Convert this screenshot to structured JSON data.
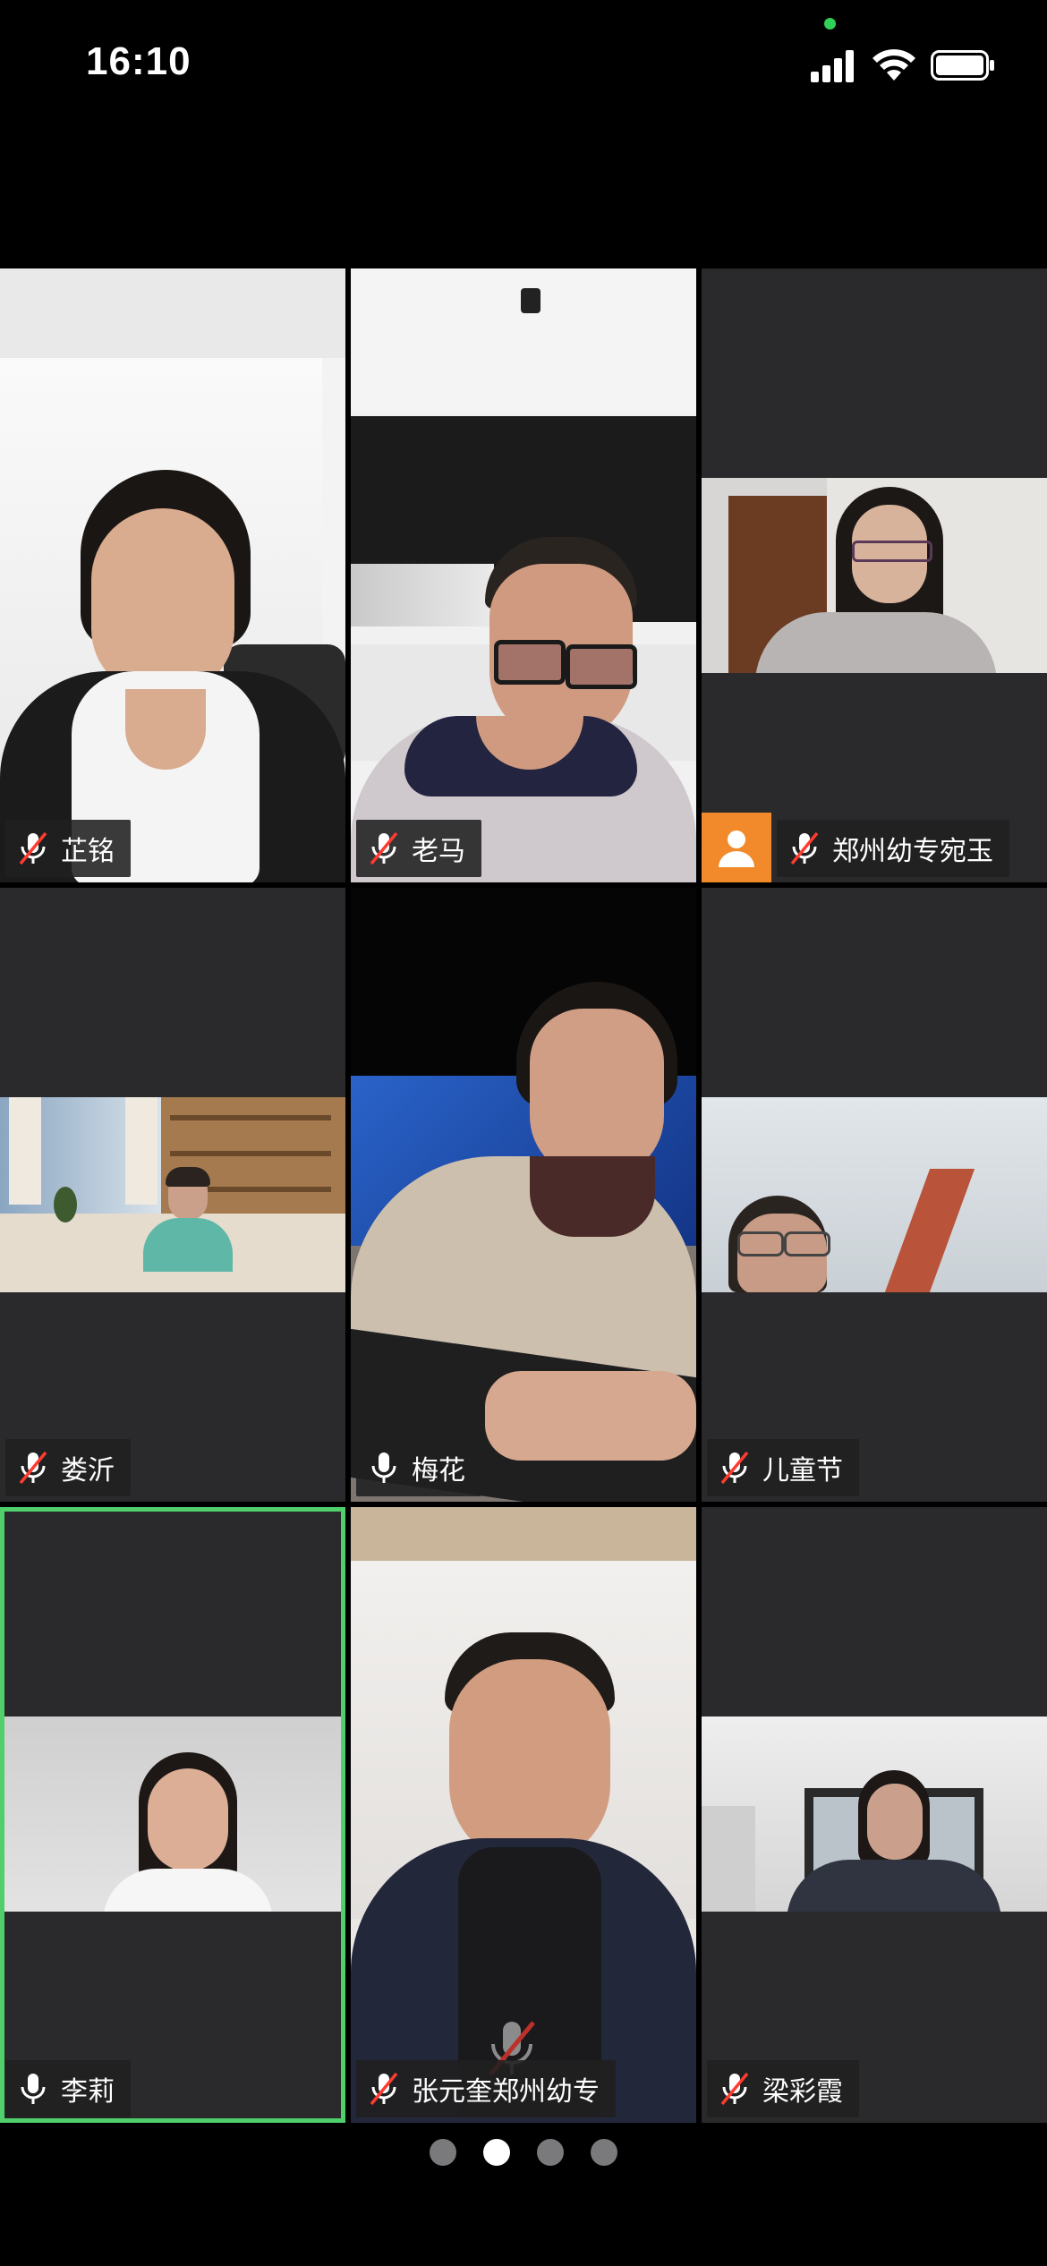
{
  "status_bar": {
    "time": "16:10"
  },
  "participants": [
    {
      "name": "芷铭",
      "mic": "muted"
    },
    {
      "name": "老马",
      "mic": "muted"
    },
    {
      "name": "郑州幼专宛玉",
      "mic": "muted",
      "avatar_badge": true
    },
    {
      "name": "娄沂",
      "mic": "muted"
    },
    {
      "name": "梅花",
      "mic": "on"
    },
    {
      "name": "儿童节",
      "mic": "muted"
    },
    {
      "name": "李莉",
      "mic": "on",
      "active_speaker": true
    },
    {
      "name": "张元奎郑州幼专",
      "mic": "muted"
    },
    {
      "name": "梁彩霞",
      "mic": "muted"
    }
  ],
  "pager": {
    "pages": 4,
    "current": 2
  },
  "colors": {
    "active_border": "#4fd06a",
    "avatar_badge": "#f28a2c",
    "tile_bg": "#2a2a2c"
  }
}
